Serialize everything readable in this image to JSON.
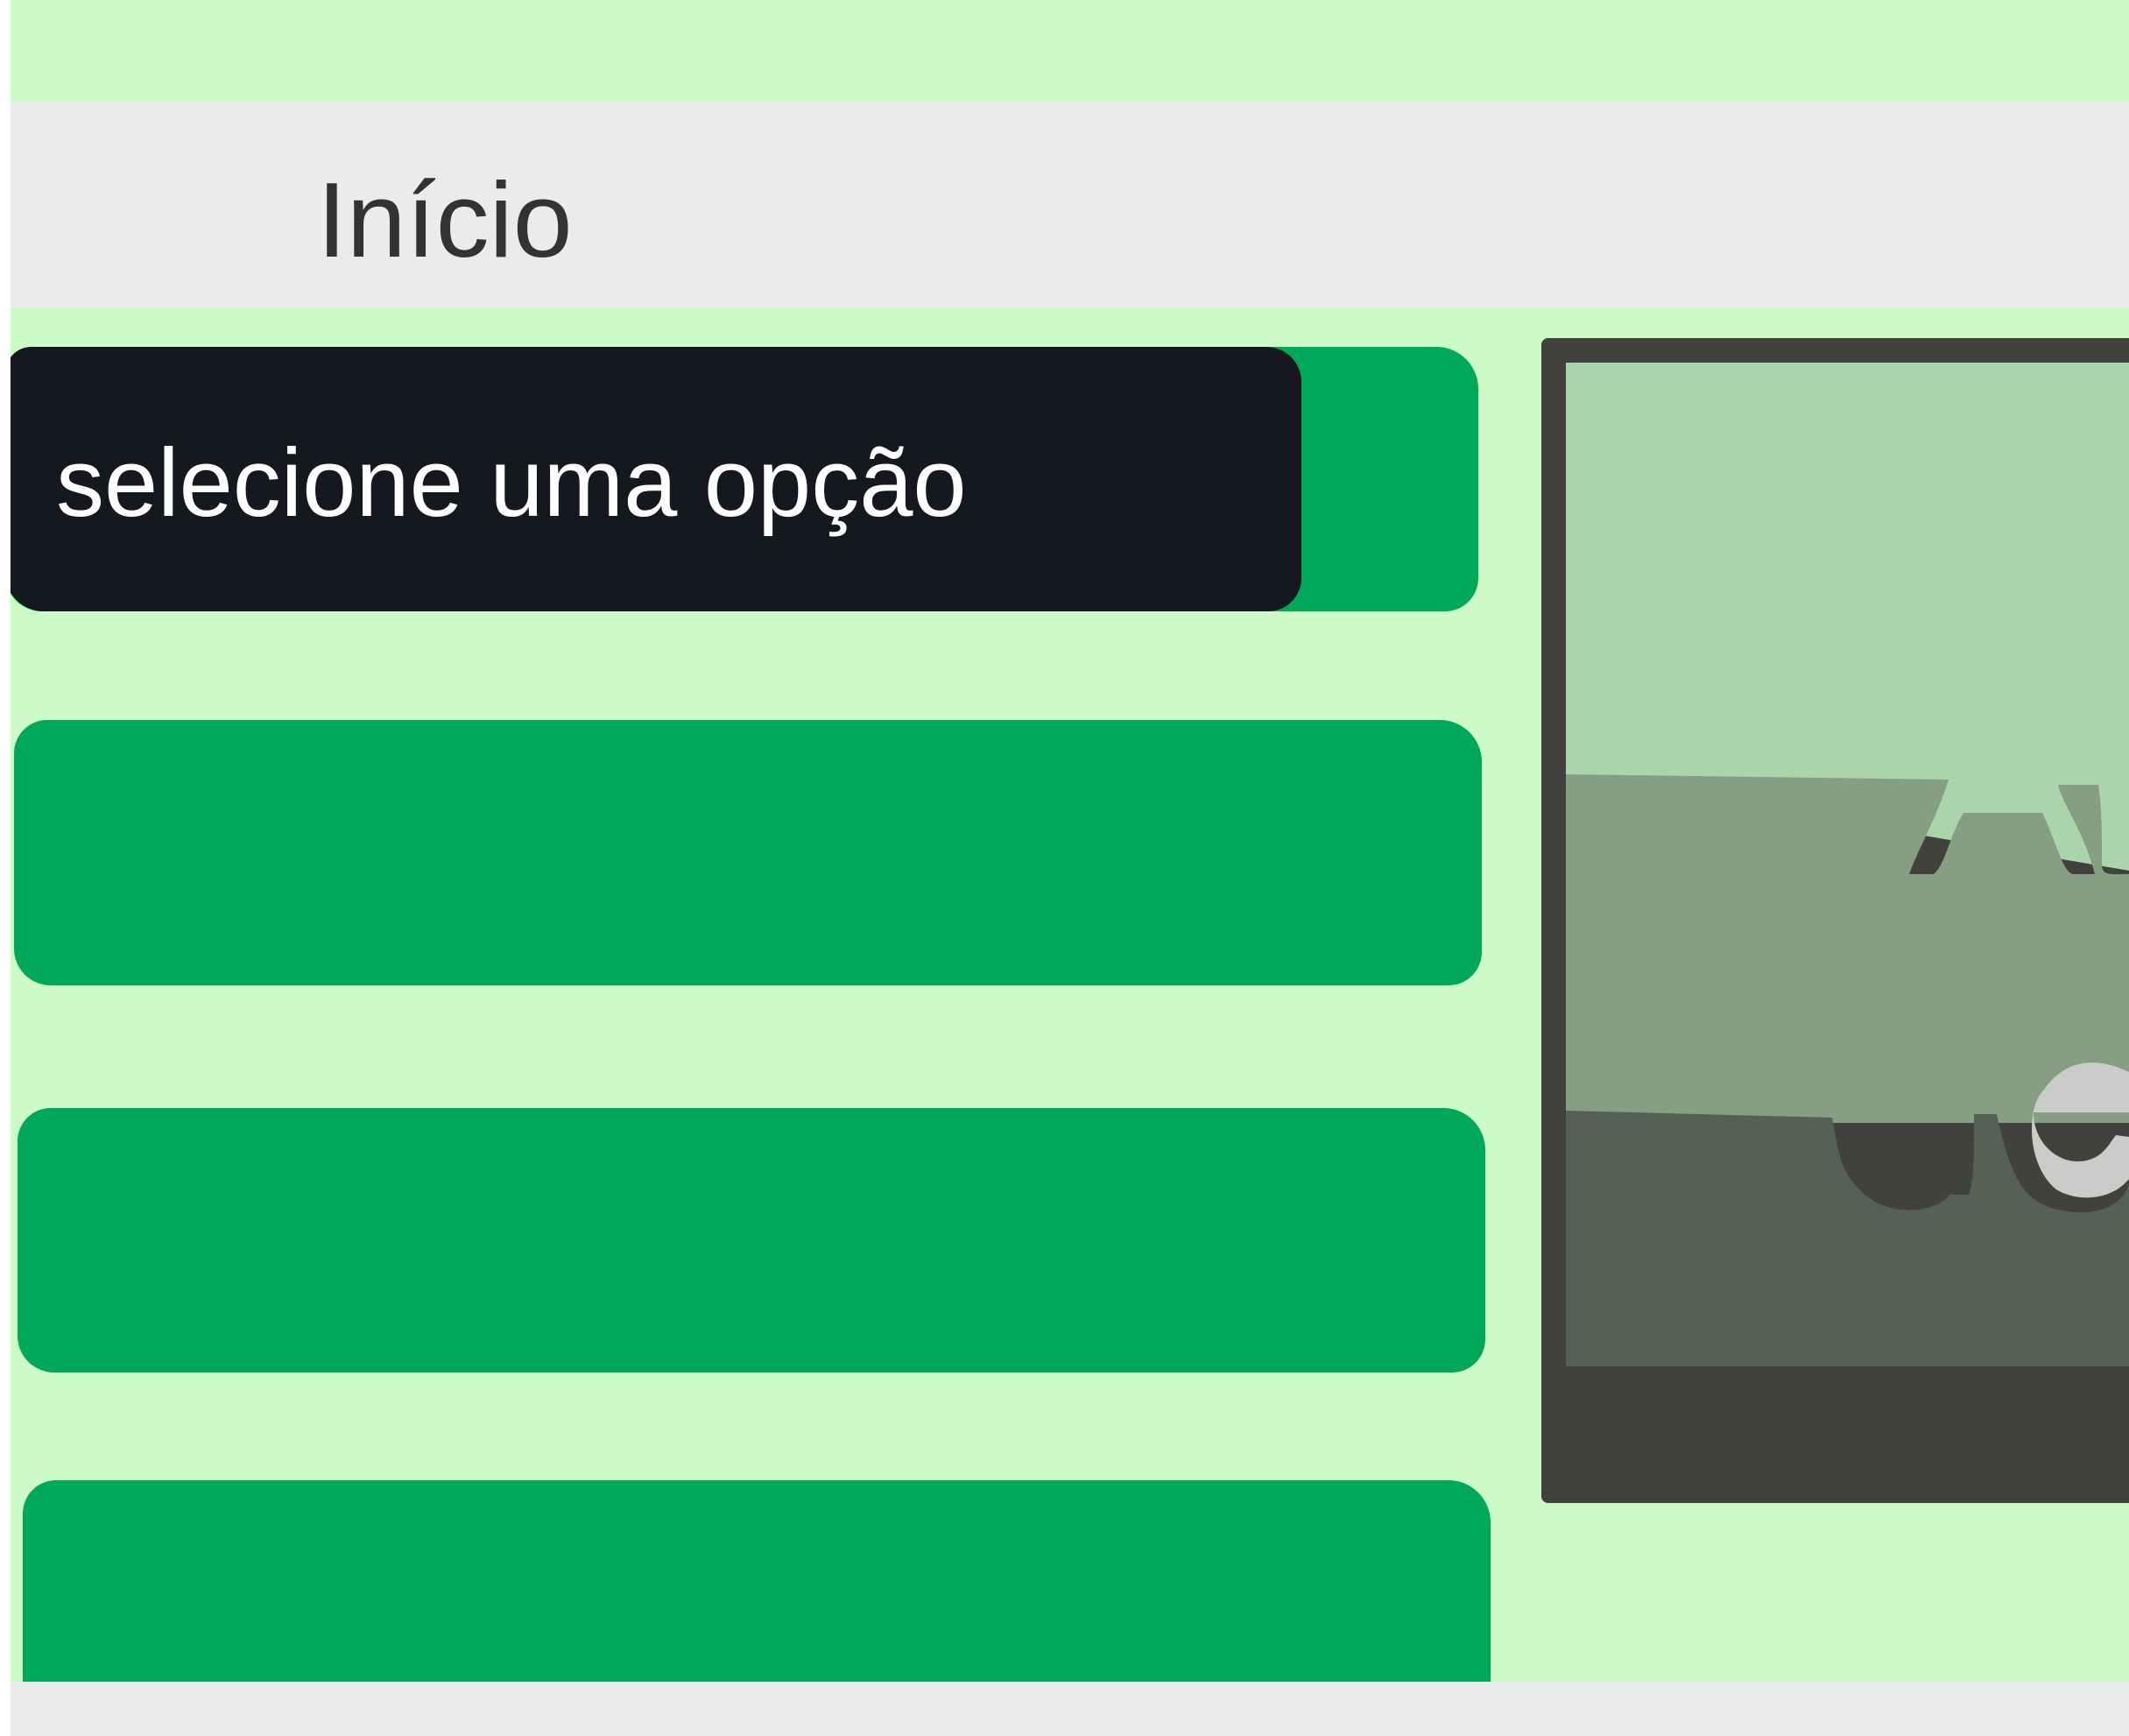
{
  "header": {
    "title": "Início"
  },
  "popup": {
    "label": "selecione uma opção"
  },
  "options": [
    {
      "label": ""
    },
    {
      "label": ""
    },
    {
      "label": ""
    },
    {
      "label": ""
    }
  ],
  "colors": {
    "top_band": "#ccfbc7",
    "header_bg": "#e9ebec",
    "content_bg": "#ccfbc7",
    "option_green": "#00a85a",
    "popup_bg": "#15181e",
    "preview_frame": "#41413d",
    "preview_light": "#aad5ab",
    "preview_mid": "#869e82",
    "preview_dark": "#566156",
    "preview_letter": "#c9ccc8"
  },
  "preview": {
    "letter": "e"
  }
}
